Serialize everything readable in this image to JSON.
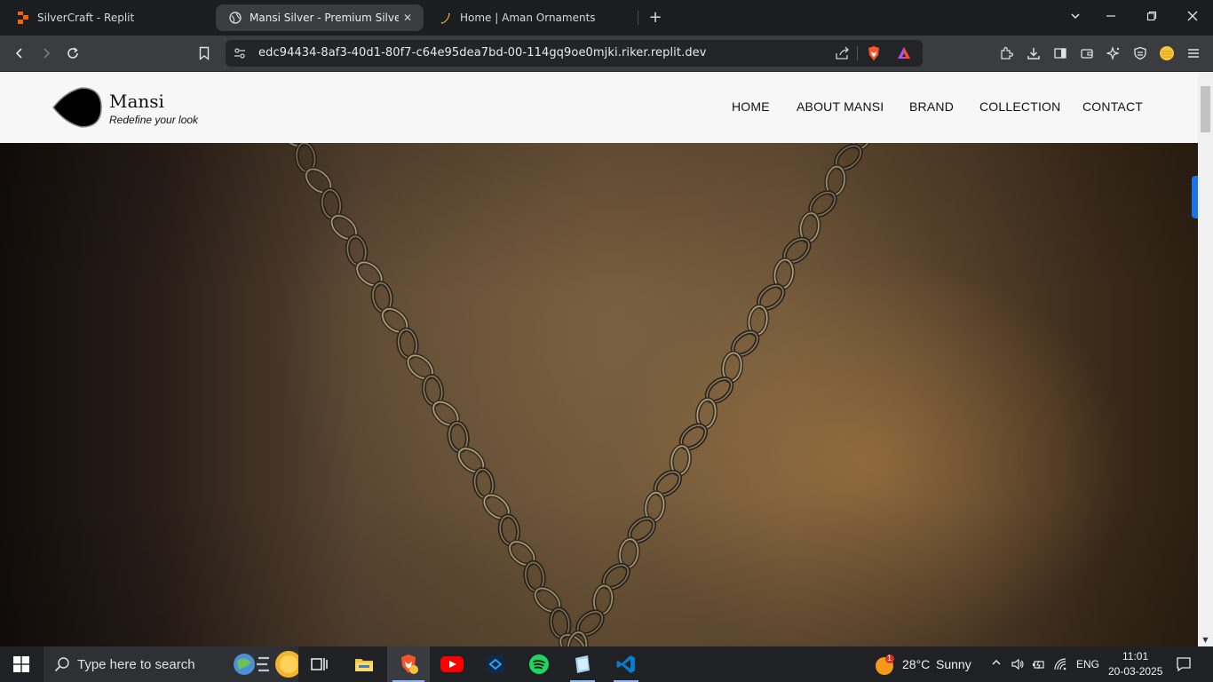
{
  "browser": {
    "tabs": [
      {
        "title": "SilverCraft - Replit",
        "icon": "replit-icon",
        "active": false
      },
      {
        "title": "Mansi Silver - Premium Silver Je",
        "icon": "globe-icon",
        "active": true
      },
      {
        "title": "Home | Aman Ornaments",
        "icon": "crescent-icon",
        "active": false
      }
    ],
    "url": "edc94434-8af3-40d1-80f7-c64e95dea7bd-00-114gq9oe0mjki.riker.replit.dev"
  },
  "site": {
    "brand": {
      "name": "Mansi",
      "tagline": "Redefine your look"
    },
    "nav": [
      "HOME",
      "ABOUT MANSI",
      "BRAND",
      "COLLECTION",
      "CONTACT"
    ]
  },
  "taskbar": {
    "search_placeholder": "Type here to search",
    "weather": {
      "temp": "28°C",
      "condition": "Sunny",
      "badge": "1"
    },
    "language": "ENG",
    "time": "11:01",
    "date": "20-03-2025"
  },
  "colors": {
    "accent": "#1a73e8",
    "nav_bg": "#f7f7f7",
    "tab_bg": "#1b1d21",
    "toolbar_bg": "#3a3c40"
  }
}
